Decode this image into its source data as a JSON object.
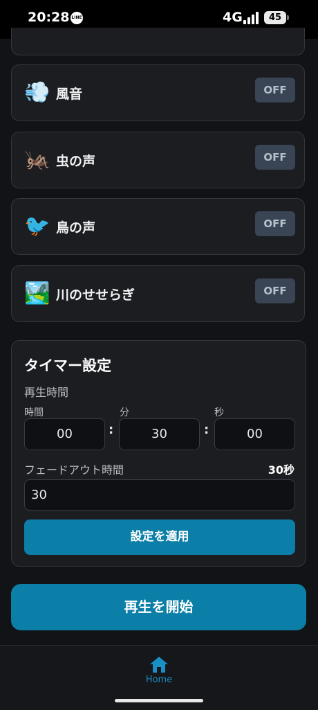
{
  "status_bar": {
    "time": "20:28",
    "line_icon": "LINE",
    "network": "4G",
    "battery": "45"
  },
  "sounds": [
    {
      "icon": "wind-icon",
      "emoji": "💨",
      "name": "風音",
      "toggle": "OFF"
    },
    {
      "icon": "cricket-icon",
      "emoji": "🦗",
      "name": "虫の声",
      "toggle": "OFF"
    },
    {
      "icon": "bird-icon",
      "emoji": "🐦",
      "name": "鳥の声",
      "toggle": "OFF"
    },
    {
      "icon": "river-icon",
      "emoji": "🏞️",
      "name": "川のせせらぎ",
      "toggle": "OFF"
    }
  ],
  "timer": {
    "title": "タイマー設定",
    "play_time_label": "再生時間",
    "hours_label": "時間",
    "hours_value": "00",
    "minutes_label": "分",
    "minutes_value": "30",
    "seconds_label": "秒",
    "seconds_value": "00",
    "colon": ":",
    "fade_label": "フェードアウト時間",
    "fade_display": "30秒",
    "fade_value": "30",
    "apply_label": "設定を適用"
  },
  "start_label": "再生を開始",
  "nav": {
    "home_label": "Home"
  },
  "colors": {
    "accent": "#0b7fa7",
    "nav_active": "#1a8fc4",
    "toggle_off_bg": "#394454"
  }
}
